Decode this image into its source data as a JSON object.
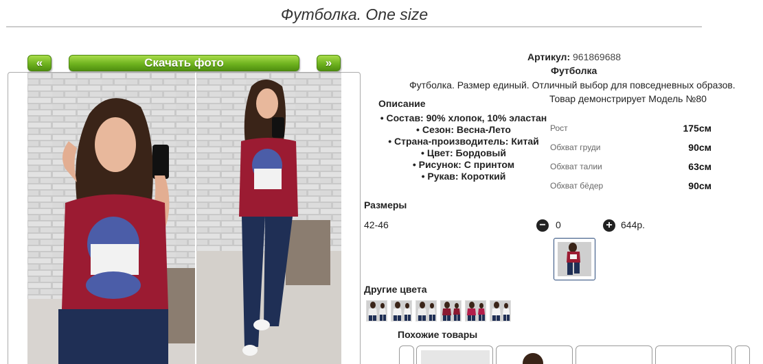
{
  "product": {
    "title": "Футболка. One size",
    "article_label": "Артикул:",
    "article_value": "961869688",
    "name": "Футболка",
    "short_description": "Футболка. Размер единый. Отличный выбор для повседневных образов."
  },
  "gallery": {
    "prev_label": "«",
    "next_label": "»",
    "download_label": "Скачать фото"
  },
  "description": {
    "heading": "Описание",
    "properties": [
      "Состав: 90% хлопок, 10% эластан",
      "Сезон: Весна-Лето",
      "Страна-производитель: Китай",
      "Цвет: Бордовый",
      "Рисунок: С принтом",
      "Рукав: Короткий"
    ]
  },
  "model": {
    "note": "Товар демонстрирует Модель №80",
    "measurements": [
      {
        "label": "Рост",
        "value": "175см"
      },
      {
        "label": "Обхват груди",
        "value": "90см"
      },
      {
        "label": "Обхват талии",
        "value": "63см"
      },
      {
        "label": "Обхват бёдер",
        "value": "90см"
      }
    ]
  },
  "sizes": {
    "heading": "Размеры",
    "rows": [
      {
        "size": "42-46",
        "minus": "−",
        "quantity": "0",
        "plus": "+",
        "price": "644р."
      }
    ]
  },
  "other_colors": {
    "heading": "Другие цвета",
    "shirt_colors": [
      "#eeeeee",
      "#f3f3f3",
      "#ededed",
      "#8a1830",
      "#b21e4a",
      "#f5f5f5"
    ]
  },
  "similar": {
    "heading": "Похожие товары"
  },
  "colors": {
    "accent_green": "#6fb31f",
    "shirt_burgundy": "#9b1b32",
    "jeans_blue": "#1f2f55"
  }
}
